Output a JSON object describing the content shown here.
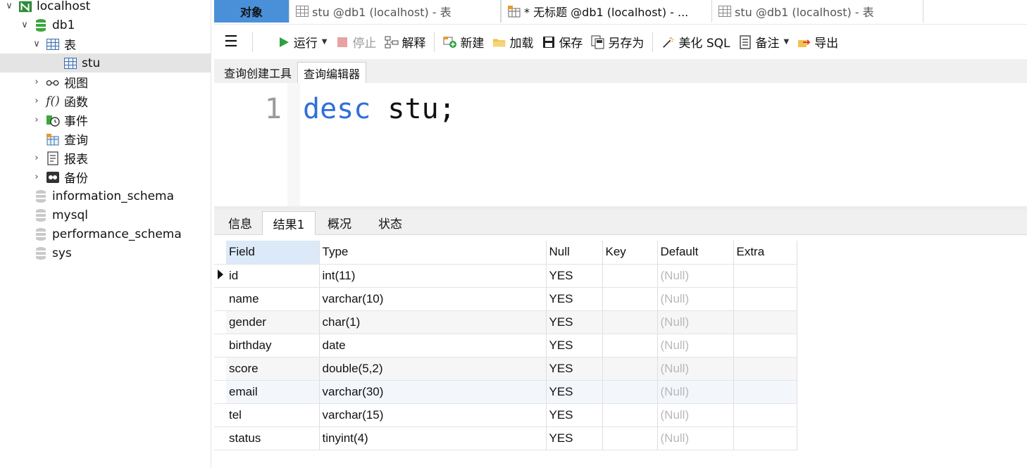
{
  "sidebar": {
    "connection": "localhost",
    "database": "db1",
    "tables_folder": "表",
    "table_item": "stu",
    "views_folder": "视图",
    "functions_folder": "函数",
    "events_folder": "事件",
    "queries_folder": "查询",
    "reports_folder": "报表",
    "backups_folder": "备份",
    "other_databases": [
      "information_schema",
      "mysql",
      "performance_schema",
      "sys"
    ]
  },
  "tabs": {
    "objects": "对象",
    "tab1": "stu @db1 (localhost) - 表",
    "tab2": "* 无标题 @db1 (localhost) - ...",
    "tab3": "stu @db1 (localhost) - 表"
  },
  "toolbar": {
    "run": "运行",
    "stop": "停止",
    "explain": "解释",
    "new": "新建",
    "load": "加载",
    "save": "保存",
    "save_as": "另存为",
    "beautify": "美化 SQL",
    "notes": "备注",
    "export": "导出"
  },
  "editor_tabs": {
    "builder": "查询创建工具",
    "editor": "查询编辑器"
  },
  "editor": {
    "line_number": "1",
    "keyword": "desc",
    "rest": " stu;"
  },
  "result_tabs": {
    "info": "信息",
    "result1": "结果1",
    "profile": "概况",
    "status": "状态"
  },
  "grid": {
    "columns": [
      "Field",
      "Type",
      "Null",
      "Key",
      "Default",
      "Extra"
    ],
    "rows": [
      {
        "field": "id",
        "type": "int(11)",
        "null": "YES",
        "key": "",
        "default": "(Null)",
        "extra": ""
      },
      {
        "field": "name",
        "type": "varchar(10)",
        "null": "YES",
        "key": "",
        "default": "(Null)",
        "extra": ""
      },
      {
        "field": "gender",
        "type": "char(1)",
        "null": "YES",
        "key": "",
        "default": "(Null)",
        "extra": ""
      },
      {
        "field": "birthday",
        "type": "date",
        "null": "YES",
        "key": "",
        "default": "(Null)",
        "extra": ""
      },
      {
        "field": "score",
        "type": "double(5,2)",
        "null": "YES",
        "key": "",
        "default": "(Null)",
        "extra": ""
      },
      {
        "field": "email",
        "type": "varchar(30)",
        "null": "YES",
        "key": "",
        "default": "(Null)",
        "extra": ""
      },
      {
        "field": "tel",
        "type": "varchar(15)",
        "null": "YES",
        "key": "",
        "default": "(Null)",
        "extra": ""
      },
      {
        "field": "status",
        "type": "tinyint(4)",
        "null": "YES",
        "key": "",
        "default": "(Null)",
        "extra": ""
      }
    ]
  }
}
